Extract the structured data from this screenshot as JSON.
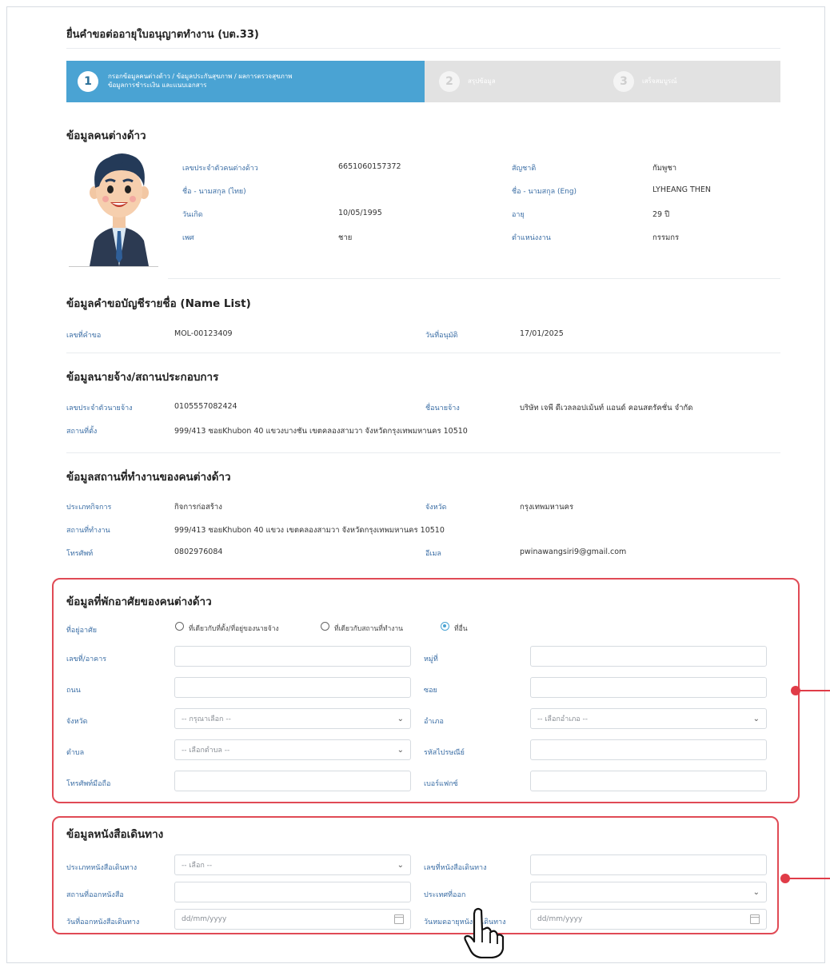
{
  "page": {
    "title": "ยื่นคำขอต่ออายุใบอนุญาตทำงาน (บต.33)"
  },
  "stepper": {
    "steps": [
      {
        "num": "1",
        "label_line1": "กรอกข้อมูลคนต่างด้าว / ข้อมูลประกันสุขภาพ / ผลการตรวจสุขภาพ",
        "label_line2": "ข้อมูลการชำระเงิน และแนบเอกสาร"
      },
      {
        "num": "2",
        "label_line1": "สรุปข้อมูล"
      },
      {
        "num": "3",
        "label_line1": "เสร็จสมบูรณ์"
      }
    ]
  },
  "foreigner": {
    "heading": "ข้อมูลคนต่างด้าว",
    "fields": [
      {
        "label": "เลขประจำตัวคนต่างด้าว",
        "value": "6651060157372"
      },
      {
        "label": "ชื่อ - นามสกุล (ไทย)",
        "value": ""
      },
      {
        "label": "วันเกิด",
        "value": "10/05/1995"
      },
      {
        "label": "เพศ",
        "value": "ชาย"
      },
      {
        "label": "สัญชาติ",
        "value": "กัมพูชา"
      },
      {
        "label": "ชื่อ - นามสกุล (Eng)",
        "value": "LYHEANG THEN"
      },
      {
        "label": "อายุ",
        "value": "29 ปี"
      },
      {
        "label": "ตำแหน่งงาน",
        "value": "กรรมกร"
      }
    ]
  },
  "namelist": {
    "heading": "ข้อมูลคำขอบัญชีรายชื่อ (Name List)",
    "request_no_label": "เลขที่คำขอ",
    "request_no": "MOL-00123409",
    "approve_label": "วันที่อนุมัติ",
    "approve_date": "17/01/2025"
  },
  "employer": {
    "heading": "ข้อมูลนายจ้าง/สถานประกอบการ",
    "id_label": "เลขประจำตัวนายจ้าง",
    "id": "0105557082424",
    "name_label": "ชื่อนายจ้าง",
    "name": "บริษัท เจพี ดีเวลลอปเม้นท์ แอนด์ คอนสตรัคชั่น จำกัด",
    "address_label": "สถานที่ตั้ง",
    "address": "999/413 ซอยKhubon 40 แขวงบางชัน เขตคลองสามวา จังหวัดกรุงเทพมหานคร 10510"
  },
  "workplace": {
    "heading": "ข้อมูลสถานที่ทำงานของคนต่างด้าว",
    "biz_label": "ประเภทกิจการ",
    "biz": "กิจการก่อสร้าง",
    "province_label": "จังหวัด",
    "province": "กรุงเทพมหานคร",
    "address_label": "สถานที่ทำงาน",
    "address": "999/413 ซอยKhubon 40 แขวง เขตคลองสามวา จังหวัดกรุงเทพมหานคร 10510",
    "phone_label": "โทรศัพท์",
    "phone": "0802976084",
    "email_label": "อีเมล",
    "email": "pwinawangsiri9@gmail.com"
  },
  "residence": {
    "heading": "ข้อมูลที่พักอาศัยของคนต่างด้าว",
    "type_label": "ที่อยู่อาศัย",
    "radio1": "ที่เดียวกับที่ตั้ง/ที่อยู่ของนายจ้าง",
    "radio2": "ที่เดียวกับสถานที่ทำงาน",
    "radio3": "ที่อื่น",
    "house_no_label": "เลขที่/อาคาร",
    "moo_label": "หมู่ที่",
    "road_label": "ถนน",
    "soi_label": "ซอย",
    "province_label": "จังหวัด",
    "province_placeholder": "-- กรุณาเลือก --",
    "district_label": "อำเภอ",
    "district_placeholder": "-- เลือกอำเภอ --",
    "subdistrict_label": "ตำบล",
    "subdistrict_placeholder": "-- เลือกตำบล --",
    "zip_label": "รหัสไปรษณีย์",
    "mobile_label": "โทรศัพท์มือถือ",
    "fax_label": "เบอร์แฟกซ์"
  },
  "passport": {
    "heading": "ข้อมูลหนังสือเดินทาง",
    "type_label": "ประเภทหนังสือเดินทาง",
    "type_placeholder": "-- เลือก --",
    "no_label": "เลขที่หนังสือเดินทาง",
    "issue_place_label": "สถานที่ออกหนังสือ",
    "country_label": "ประเทศที่ออก",
    "issue_date_label": "วันที่ออกหนังสือเดินทาง",
    "issue_date_placeholder": "dd/mm/yyyy",
    "expire_label": "วันหมดอายุหนังสือเดินทาง",
    "expire_placeholder": "dd/mm/yyyy"
  },
  "colors": {
    "accent": "#4aa3d3",
    "label": "#3b6ea5",
    "highlight": "#e04a55"
  }
}
